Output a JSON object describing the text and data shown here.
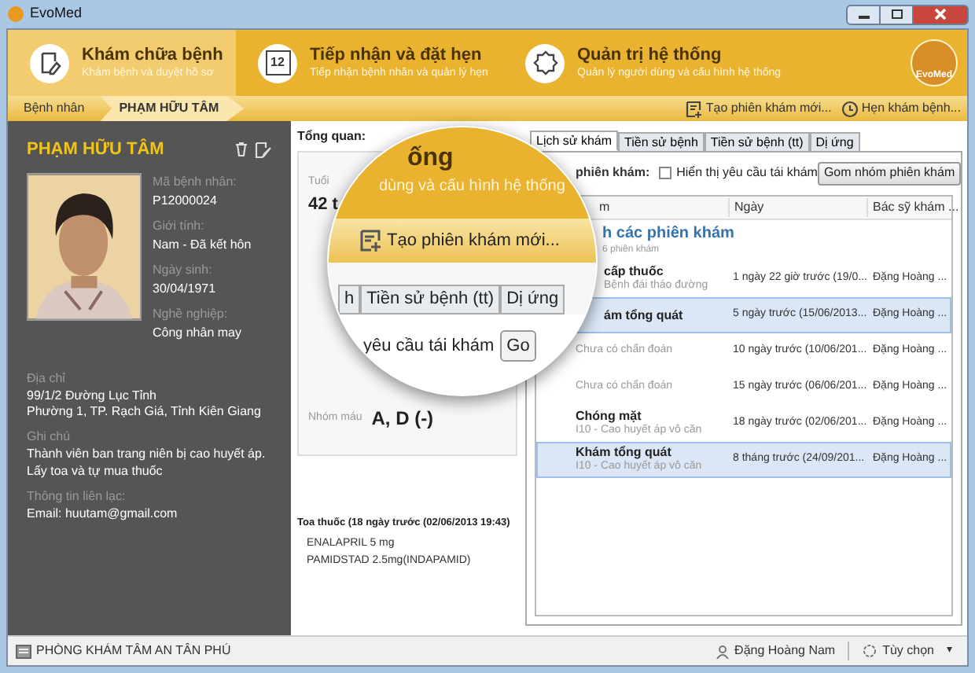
{
  "window": {
    "title": "EvoMed"
  },
  "modules": [
    {
      "title": "Khám chữa bệnh",
      "subtitle": "Khám bệnh và duyệt hồ sơ",
      "selected": true
    },
    {
      "title": "Tiếp nhận và đặt hẹn",
      "subtitle": "Tiếp nhận bệnh nhân và quản lý hẹn",
      "calendar_day": "12",
      "selected": false
    },
    {
      "title": "Quản trị hệ thống",
      "subtitle": "Quản lý người dùng và cấu hình hệ thống",
      "selected": false
    }
  ],
  "logo_text": "EvoMed",
  "breadcrumb": [
    "Bệnh nhân",
    "PHẠM HỮU TÂM"
  ],
  "toolbar_actions": [
    {
      "label": "Tạo phiên khám mới..."
    },
    {
      "label": "Hẹn khám bệnh..."
    }
  ],
  "patient": {
    "name": "PHẠM HỮU TÂM",
    "fields": [
      {
        "label": "Mã bệnh nhân:",
        "value": "P12000024"
      },
      {
        "label": "Giới tính:",
        "value": "Nam - Đã kết hôn"
      },
      {
        "label": "Ngày sinh:",
        "value": "30/04/1971"
      },
      {
        "label": "Nghề nghiệp:",
        "value": "Công nhân may"
      }
    ],
    "details": [
      {
        "label": "Địa chỉ",
        "lines": [
          "99/1/2 Đường Lục Tỉnh",
          "Phường 1, TP. Rạch Giá, Tỉnh Kiên Giang"
        ]
      },
      {
        "label": "Ghi chú",
        "lines": [
          "Thành viên ban trang niên bị cao huyết áp. Lấy toa và tự mua thuốc"
        ]
      },
      {
        "label": "Thông tin liên lạc:",
        "lines": [
          "Email: huutam@gmail.com"
        ]
      }
    ]
  },
  "overview": {
    "title": "Tổng quan:",
    "age_label": "Tuổi",
    "age_value": "42 t",
    "blood_label": "Nhóm máu",
    "blood_value": "A, D (-)"
  },
  "prescription": {
    "title": "Toa thuốc (18 ngày trước (02/06/2013 19:43)",
    "items": [
      "ENALAPRIL 5 mg",
      "PAMIDSTAD 2.5mg(INDAPAMID)"
    ]
  },
  "tabs": [
    {
      "label": "Lịch sử khám",
      "selected": true
    },
    {
      "label": "Tiền sử bệnh",
      "selected": false
    },
    {
      "label": "Tiền sử bệnh (tt)",
      "selected": false
    },
    {
      "label": "Dị ứng",
      "selected": false
    }
  ],
  "filter": {
    "label": "phiên khám:",
    "checkbox": {
      "label": "Hiển thị yêu cầu tái khám",
      "checked": false
    },
    "button": "Gom nhóm phiên khám"
  },
  "table": {
    "columns": [
      "m",
      "Ngày",
      "Bác sỹ khám ..."
    ],
    "rows": [
      {
        "kind": "group",
        "title": "h các phiên khám",
        "subtitle": "6 phiên khám",
        "selected": false
      },
      {
        "kind": "visit",
        "title": "cấp thuốc",
        "subtitle": "Bệnh đái tháo đường",
        "date": "1 ngày 22 giờ trước (19/0...",
        "doctor": "Đặng Hoàng ...",
        "selected": false
      },
      {
        "kind": "visit",
        "title": "ám tổng quát",
        "date": "5 ngày trước (15/06/2013...",
        "doctor": "Đặng Hoàng ...",
        "selected": true
      },
      {
        "kind": "visit",
        "subtitle": "Chưa có chẩn đoán",
        "date": "10 ngày trước (10/06/201...",
        "doctor": "Đặng Hoàng ...",
        "selected": false
      },
      {
        "kind": "visit",
        "subtitle": "Chưa có chẩn đoán",
        "date": "15 ngày trước (06/06/201...",
        "doctor": "Đặng Hoàng ...",
        "selected": false
      },
      {
        "kind": "visit",
        "title": "Chóng mặt",
        "subtitle": "I10 - Cao huyết áp vô căn",
        "date": "18 ngày trước (02/06/201...",
        "doctor": "Đặng Hoàng ...",
        "selected": false
      },
      {
        "kind": "visit",
        "title": "Khám tổng quát",
        "subtitle": "I10 - Cao huyết áp vô căn",
        "date": "8 tháng trước (24/09/201...",
        "doctor": "Đặng Hoàng ...",
        "selected": true
      }
    ]
  },
  "magnifier": {
    "heading": "ống",
    "subheading": "dùng và cấu hình hệ thống",
    "action": "Tạo phiên khám mới...",
    "tabs": [
      "h",
      "Tiền sử bệnh (tt)",
      "Dị ứng"
    ],
    "text": "yêu cầu tái khám",
    "button": "Go"
  },
  "status_bar": {
    "clinic": "PHÒNG KHÁM TÂM AN TÂN PHÚ",
    "user": "Đặng Hoàng Nam",
    "options": "Tùy chọn",
    "caret": "▾"
  }
}
